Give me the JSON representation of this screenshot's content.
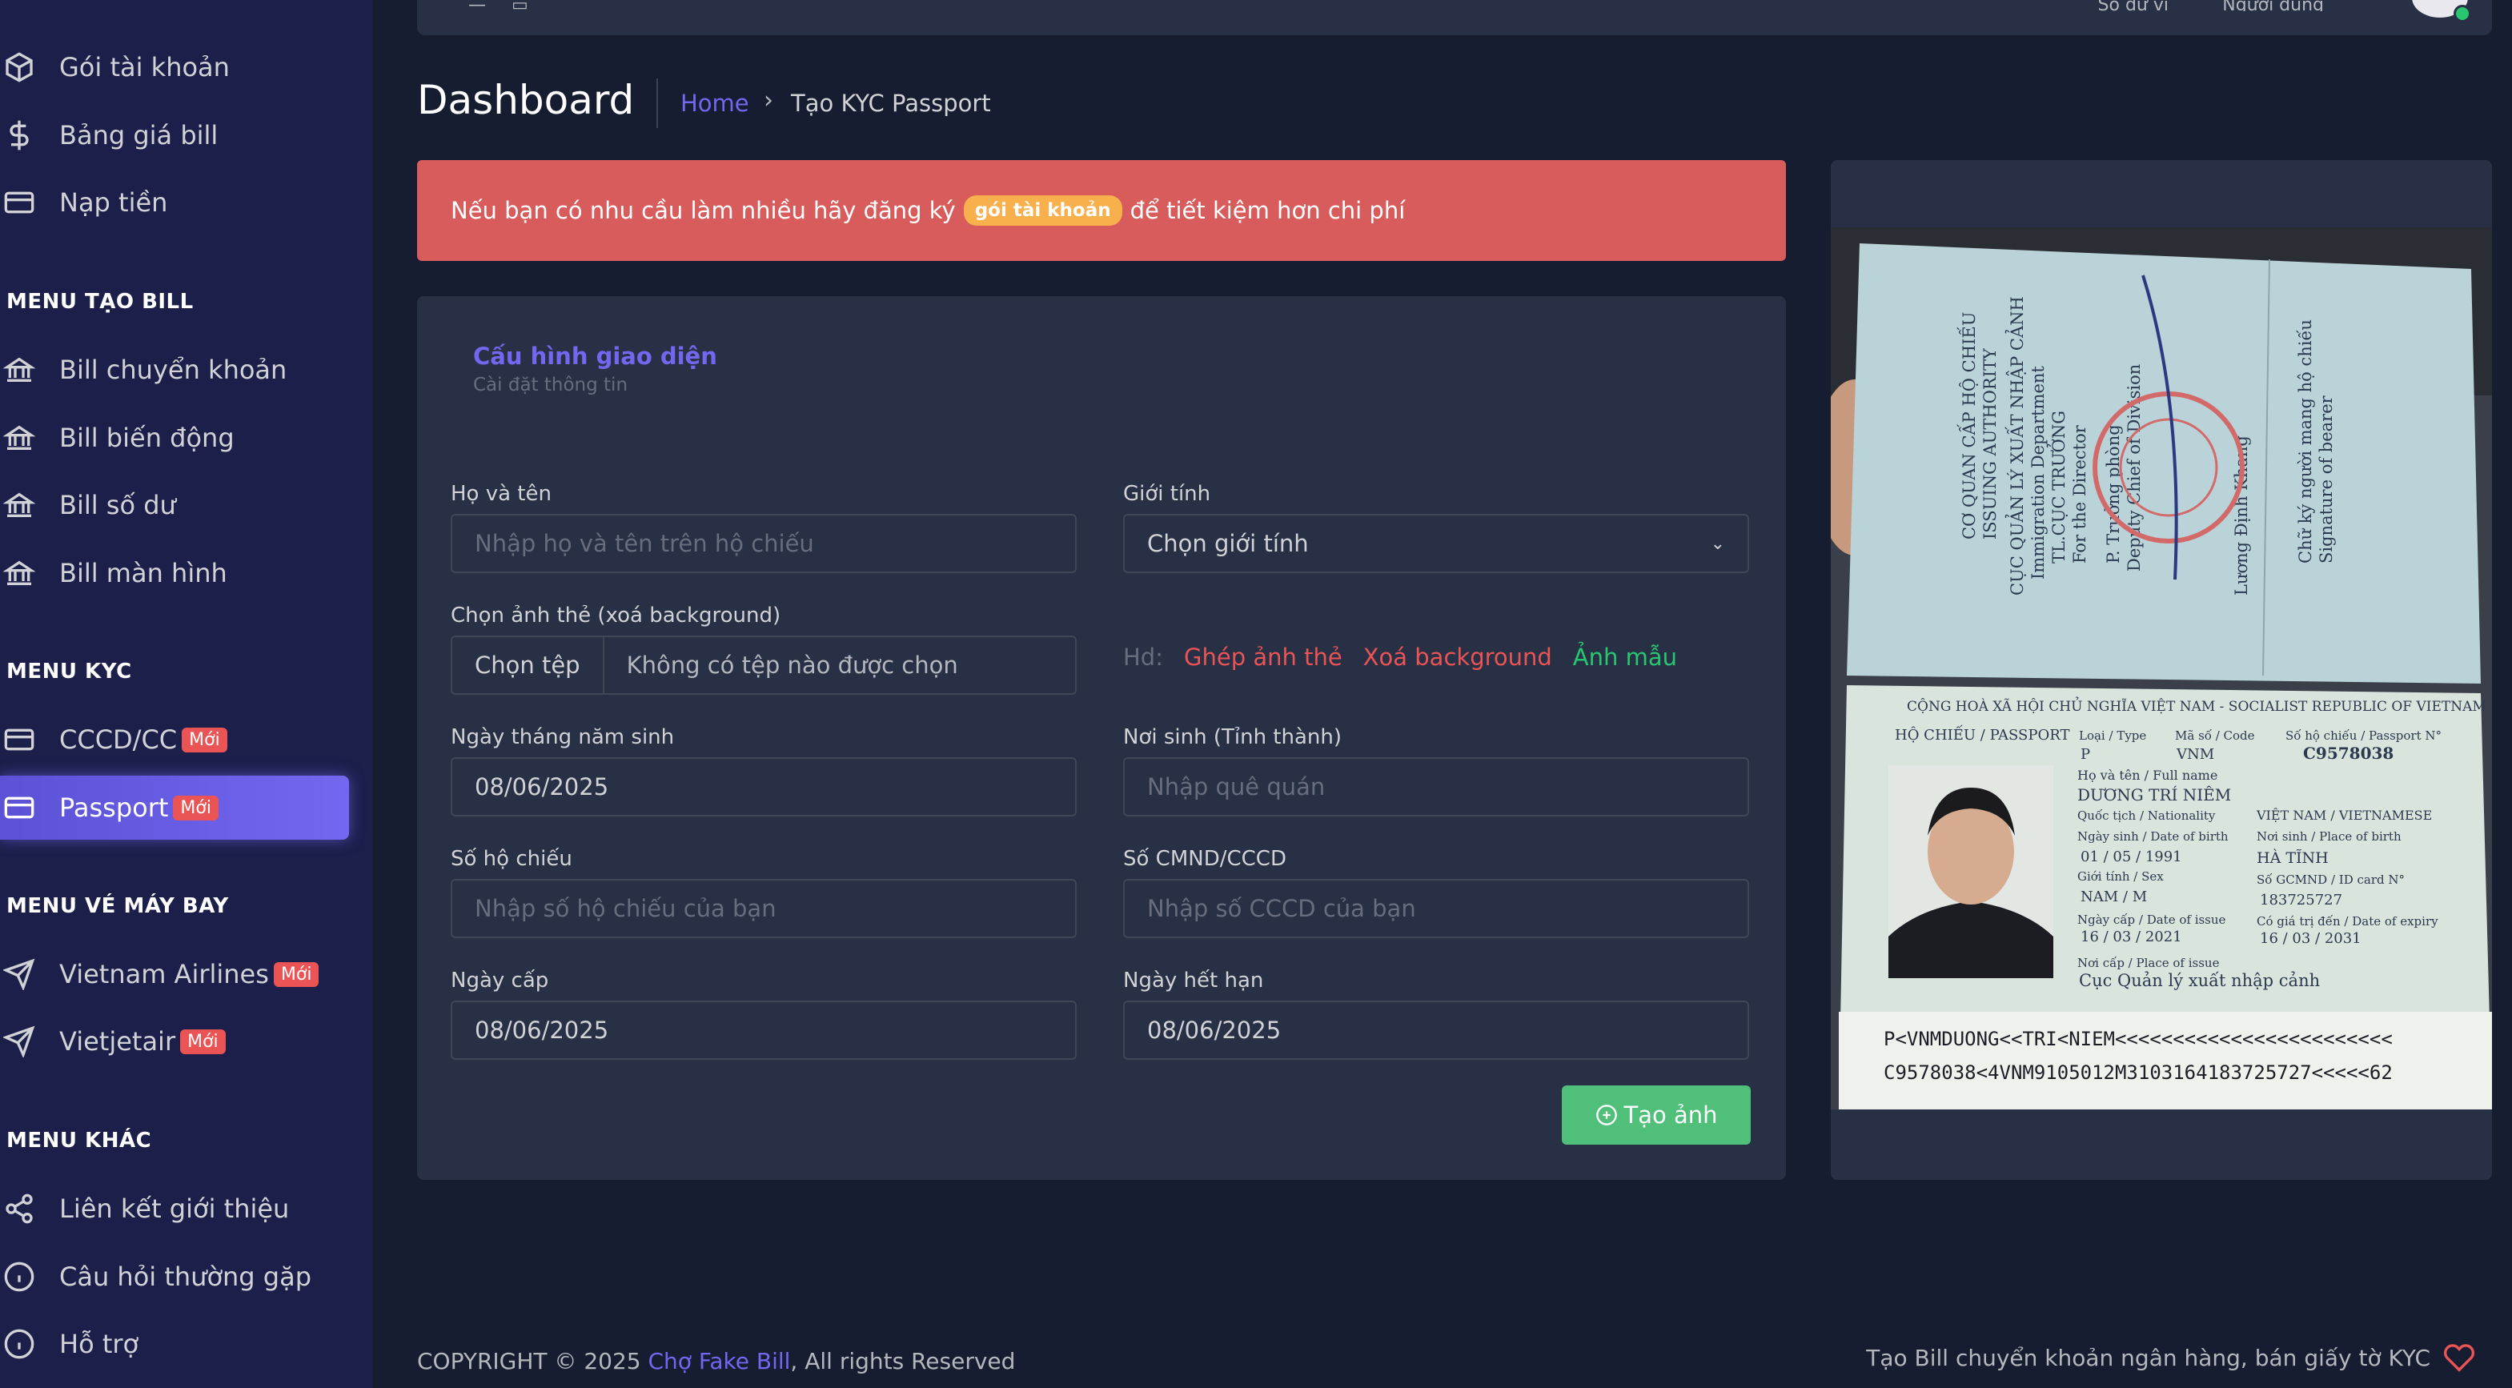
{
  "sidebar": {
    "items_top": [
      {
        "label": "Gói tài khoản",
        "icon": "package-icon"
      },
      {
        "label": "Bảng giá bill",
        "icon": "dollar-icon"
      },
      {
        "label": "Nạp tiền",
        "icon": "credit-card-icon"
      }
    ],
    "section_bill": "MENU TẠO BILL",
    "bill_items": [
      {
        "label": "Bill chuyển khoản",
        "icon": "bank-icon"
      },
      {
        "label": "Bill biến động",
        "icon": "bank-icon"
      },
      {
        "label": "Bill số dư",
        "icon": "bank-icon"
      },
      {
        "label": "Bill màn hình",
        "icon": "bank-icon"
      }
    ],
    "section_kyc": "MENU KYC",
    "kyc_items": [
      {
        "label": "CCCD/CC",
        "badge": "Mới",
        "icon": "credit-card-icon"
      },
      {
        "label": "Passport",
        "badge": "Mới",
        "icon": "credit-card-icon",
        "active": true
      }
    ],
    "section_flight": "MENU VÉ MÁY BAY",
    "flight_items": [
      {
        "label": "Vietnam Airlines",
        "badge": "Mới",
        "icon": "send-icon"
      },
      {
        "label": "Vietjetair",
        "badge": "Mới",
        "icon": "send-icon"
      }
    ],
    "section_other": "MENU KHÁC",
    "other_items": [
      {
        "label": "Liên kết giới thiệu",
        "icon": "share-icon"
      },
      {
        "label": "Câu hỏi thường gặp",
        "icon": "info-icon"
      },
      {
        "label": "Hỗ trợ",
        "icon": "info-icon"
      }
    ]
  },
  "topbar": {
    "balance_label": "Số dư ví",
    "user_label": "Người dùng"
  },
  "header": {
    "title": "Dashboard",
    "breadcrumb_home": "Home",
    "breadcrumb_sep": "›",
    "breadcrumb_current": "Tạo KYC Passport"
  },
  "alert": {
    "before": "Nếu bạn có nhu cầu làm nhiều hãy đăng ký",
    "pill": "gói tài khoản",
    "after": "để tiết kiệm hơn chi phí"
  },
  "form": {
    "card_title": "Cấu hình giao diện",
    "card_subtitle": "Cài đặt thông tin",
    "fullname_label": "Họ và tên",
    "fullname_placeholder": "Nhập họ và tên trên hộ chiếu",
    "gender_label": "Giới tính",
    "gender_value": "Chọn giới tính",
    "photo_label": "Chọn ảnh thẻ (xoá background)",
    "file_button": "Chọn tệp",
    "file_status": "Không có tệp nào được chọn",
    "hd_label": "Hd:",
    "hd_links": [
      "Ghép ảnh thẻ",
      "Xoá background",
      "Ảnh mẫu"
    ],
    "dob_label": "Ngày tháng năm sinh",
    "dob_value": "08/06/2025",
    "birthplace_label": "Nơi sinh (Tỉnh thành)",
    "birthplace_placeholder": "Nhập quê quán",
    "passport_no_label": "Số hộ chiếu",
    "passport_no_placeholder": "Nhập số hộ chiếu của bạn",
    "id_label": "Số CMND/CCCD",
    "id_placeholder": "Nhập số CCCD của bạn",
    "issue_label": "Ngày cấp",
    "issue_value": "08/06/2025",
    "expiry_label": "Ngày hết hạn",
    "expiry_value": "08/06/2025",
    "create_button": "Tạo ảnh"
  },
  "passport": {
    "authority_1": "CƠ QUAN CẤP HỘ CHIẾU",
    "authority_2": "ISSUING AUTHORITY",
    "authority_3": "CỤC QUẢN LÝ XUẤT NHẬP CẢNH",
    "authority_4": "Immigration Department",
    "authority_5": "TL.CỤC TRƯỞNG",
    "authority_6": "For the Director",
    "authority_7": "P. Trưởng phòng",
    "authority_8": "Deputy Chief of Division",
    "signer": "Lương Định Khang",
    "bearer_sig_1": "Chữ ký người mang hộ chiếu",
    "bearer_sig_2": "Signature of bearer",
    "republic": "CỘNG HOÀ XÃ HỘI CHỦ NGHĨA VIỆT NAM - SOCIALIST REPUBLIC OF VIETNAM",
    "doc_title": "HỘ CHIẾU / PASSPORT",
    "type_label": "Loại / Type",
    "type": "P",
    "code_label": "Mã số / Code",
    "code": "VNM",
    "number_label": "Số hộ chiếu / Passport N°",
    "number": "C9578038",
    "name_label": "Họ và tên / Full name",
    "name": "DƯƠNG TRÍ NIÊM",
    "nationality_label": "Quốc tịch / Nationality",
    "nationality": "VIỆT NAM / VIETNAMESE",
    "dob_label": "Ngày sinh / Date of birth",
    "dob": "01 / 05 / 1991",
    "pob_label": "Nơi sinh / Place of birth",
    "pob": "HÀ TĨNH",
    "sex_label": "Giới tính / Sex",
    "sex": "NAM / M",
    "idno_label": "Số GCMND / ID card N°",
    "idno": "183725727",
    "issue_label": "Ngày cấp / Date of issue",
    "issue": "16 / 03 / 2021",
    "expiry_label": "Có giá trị đến / Date of expiry",
    "expiry": "16 / 03 / 2031",
    "place_label": "Nơi cấp / Place of issue",
    "place": "Cục Quản lý xuất nhập cảnh",
    "mrz_1": "P<VNMDUONG<<TRI<NIEM<<<<<<<<<<<<<<<<<<<<<<<<",
    "mrz_2": "C9578038<4VNM9105012M3103164183725727<<<<<62"
  },
  "footer": {
    "copyright": "COPYRIGHT © 2025",
    "brand": "Chợ Fake Bill",
    "rights": ", All rights Reserved",
    "tagline": "Tạo Bill chuyển khoản ngân hàng, bán giấy tờ KYC"
  },
  "colors": {
    "primary": "#7367f0",
    "danger": "#ea5455",
    "success": "#4fbf7a",
    "warning": "#f7b04b",
    "body_bg": "#161d31",
    "card_bg": "#283046",
    "sidebar_bg": "#1b1f4a"
  }
}
